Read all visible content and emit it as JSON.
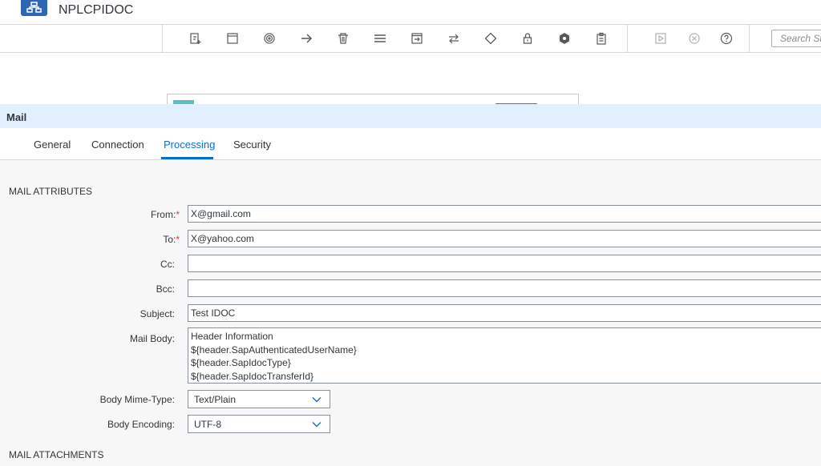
{
  "app": {
    "title": "NPLCPIDOC"
  },
  "toolbar": {
    "icons": [
      "add-flow-step-icon",
      "participant-icon",
      "event-icon",
      "connector-icon",
      "delete-icon",
      "menu-icon",
      "process-icon",
      "call-icon",
      "gateway-icon",
      "security-icon",
      "message-transformer-icon",
      "clipboard-icon",
      "run-icon",
      "cancel-run-icon",
      "help-icon"
    ],
    "search_placeholder": "Search Step"
  },
  "panel": {
    "title": "Mail",
    "tabs": [
      "General",
      "Connection",
      "Processing",
      "Security"
    ],
    "active_tab": "Processing"
  },
  "mail_attributes": {
    "section_title": "MAIL ATTRIBUTES",
    "from": {
      "label": "From:",
      "value": "X@gmail.com",
      "required_mark": "*"
    },
    "to": {
      "label": "To:",
      "value": "X@yahoo.com",
      "required_mark": "*"
    },
    "cc": {
      "label": "Cc:",
      "value": ""
    },
    "bcc": {
      "label": "Bcc:",
      "value": ""
    },
    "subject": {
      "label": "Subject:",
      "value": "Test IDOC"
    },
    "mail_body": {
      "label": "Mail Body:",
      "lines": [
        "Header Information",
        "${header.SapAuthenticatedUserName}",
        "${header.SapIdocType}",
        "${header.SapIdocTransferId}"
      ]
    },
    "body_mime_type": {
      "label": "Body Mime-Type:",
      "value": "Text/Plain"
    },
    "body_encoding": {
      "label": "Body Encoding:",
      "value": "UTF-8"
    }
  },
  "mail_attachments": {
    "section_title": "MAIL ATTACHMENTS"
  },
  "colors": {
    "accent": "#0a6ed1",
    "panel_header": "#e2efff",
    "logo": "#2e66b3",
    "required": "#d04343"
  }
}
